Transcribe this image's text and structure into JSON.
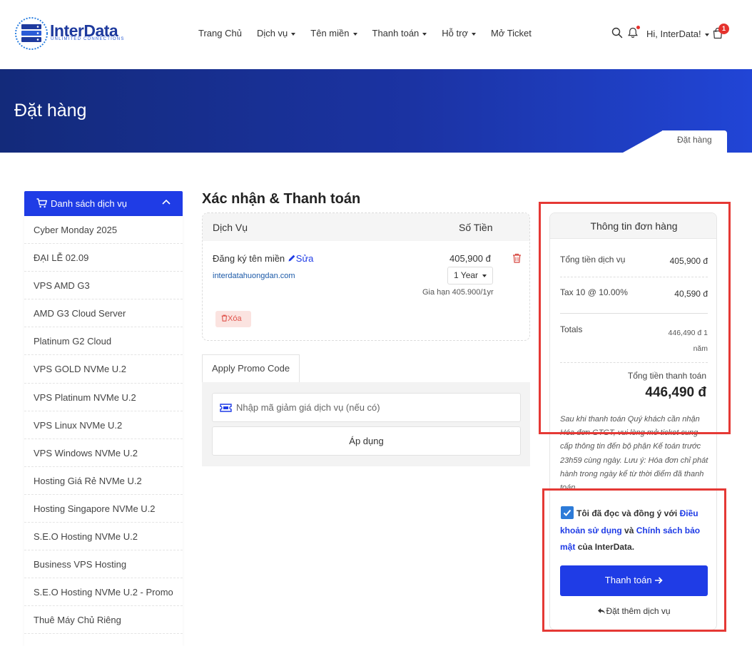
{
  "brand": {
    "name": "InterData",
    "tagline": "UNLIMITED CONNECTIONS",
    "primary_color": "#1f3ce6"
  },
  "nav": {
    "items": [
      {
        "label": "Trang Chủ",
        "dropdown": false
      },
      {
        "label": "Dịch vụ",
        "dropdown": true
      },
      {
        "label": "Tên miền",
        "dropdown": true
      },
      {
        "label": "Thanh toán",
        "dropdown": true
      },
      {
        "label": "Hỗ trợ",
        "dropdown": true
      },
      {
        "label": "Mở Ticket",
        "dropdown": false
      }
    ],
    "user_label": "Hi, InterData!",
    "cart_count": "1"
  },
  "banner": {
    "title": "Đặt hàng",
    "breadcrumb": "Đặt hàng"
  },
  "sidebar": {
    "title": "Danh sách dịch vụ",
    "items": [
      "Cyber Monday 2025",
      "ĐẠI LỄ 02.09",
      "VPS AMD G3",
      "AMD G3 Cloud Server",
      "Platinum G2 Cloud",
      "VPS GOLD NVMe U.2",
      "VPS Platinum NVMe U.2",
      "VPS Linux NVMe U.2",
      "VPS Windows NVMe U.2",
      "Hosting Giá Rẻ NVMe U.2",
      "Hosting Singapore NVMe U.2",
      "S.E.O Hosting NVMe U.2",
      "Business VPS Hosting",
      "S.E.O Hosting NVMe U.2 - Promo",
      "Thuê Máy Chủ Riêng"
    ]
  },
  "main": {
    "title": "Xác nhận & Thanh toán",
    "table": {
      "col_service": "Dịch Vụ",
      "col_amount": "Số Tiền"
    },
    "item": {
      "name": "Đăng ký tên miền",
      "edit_label": "Sửa",
      "domain": "interdatahuongdan.com",
      "price": "405,900 đ",
      "billing_cycle": "1 Year",
      "renewal": "Gia hạn 405.900/1yr",
      "remove_label": "Xóa"
    },
    "promo": {
      "tab_label": "Apply Promo Code",
      "placeholder": "Nhập mã giảm giá dịch vụ (nếu có)",
      "apply_label": "Áp dụng"
    }
  },
  "summary": {
    "title": "Thông tin đơn hàng",
    "subtotal_label": "Tổng tiền dịch vụ",
    "subtotal_value": "405,900 đ",
    "tax_label": "Tax 10 @ 10.00%",
    "tax_value": "40,590 đ",
    "totals_label": "Totals",
    "totals_value": "446,490 đ 1 năm",
    "grand_label": "Tổng tiền thanh toán",
    "grand_value": "446,490 đ",
    "note": "Sau khi thanh toán Quý khách cần nhận Hóa đơn GTGT, vui lòng mở ticket cung cấp thông tin đến bộ phận Kế toán trước 23h59 cùng ngày. Lưu ý: Hóa đơn chỉ phát hành trong ngày kể từ thời điểm đã thanh toán.",
    "agree_prefix": "Tôi đã đọc và đồng ý với",
    "agree_terms": "Điều khoản sử dụng",
    "agree_and": "và",
    "agree_privacy": "Chính sách bảo mật",
    "agree_suffix": "của InterData.",
    "pay_label": "Thanh toán",
    "more_label": "Đặt thêm dịch vụ"
  }
}
